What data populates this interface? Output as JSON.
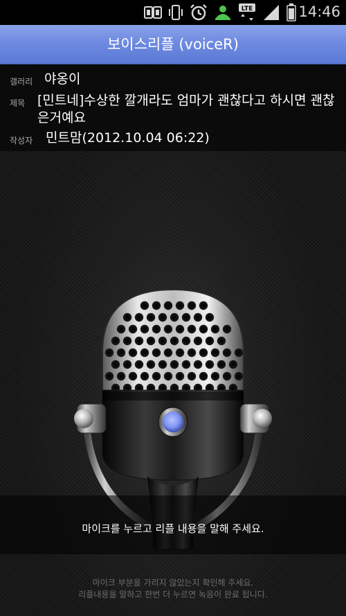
{
  "status_bar": {
    "time": "14:46",
    "network_label": "LTE",
    "icons": [
      "screen-mirror-icon",
      "vibrate-icon",
      "alarm-icon",
      "call-icon",
      "lte-data-icon",
      "signal-icon",
      "battery-icon"
    ],
    "icon_color": "#d8d8d8",
    "call_icon_color": "#4fc24f"
  },
  "titlebar": {
    "title": "보이스리플 (voiceR)",
    "color": "#6f8be0"
  },
  "post": {
    "gallery_label": "갤러리",
    "gallery_value": "야옹이",
    "subject_label": "제목",
    "subject_value": "[민트네]수상한 깔개라도 엄마가 괜찮다고 하시면 괜찮은거예요",
    "author_label": "작성자",
    "author_value": "민트맘(2012.10.04 06:22)"
  },
  "mic": {
    "button_color": "#7f93f2"
  },
  "prompt": "마이크를 누르고 리플 내용을 말해 주세요.",
  "footer": {
    "line1": "마이크 부분을 가리지 않았는지 확인해 주세요.",
    "line2": "리플내용을 말하고 한번 더 누르면 녹음이 완료 됩니다."
  }
}
